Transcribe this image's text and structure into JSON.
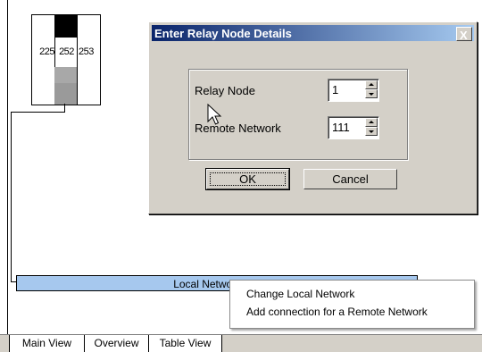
{
  "node": {
    "labels": [
      "225",
      "252",
      "253"
    ]
  },
  "network_bar": {
    "label": "Local Network:111"
  },
  "context_menu": {
    "items": [
      {
        "label": "Change Local Network"
      },
      {
        "label": "Add connection for a Remote Network"
      }
    ]
  },
  "dialog": {
    "title": "Enter Relay Node Details",
    "close_glyph": "X",
    "relay_node": {
      "label": "Relay Node",
      "value": "1"
    },
    "remote_network": {
      "label": "Remote Network",
      "value": "111"
    },
    "ok_label": "OK",
    "cancel_label": "Cancel"
  },
  "tabs": [
    {
      "label": "Main View",
      "active": true
    },
    {
      "label": "Overview",
      "active": false
    },
    {
      "label": "Table View",
      "active": false
    }
  ]
}
